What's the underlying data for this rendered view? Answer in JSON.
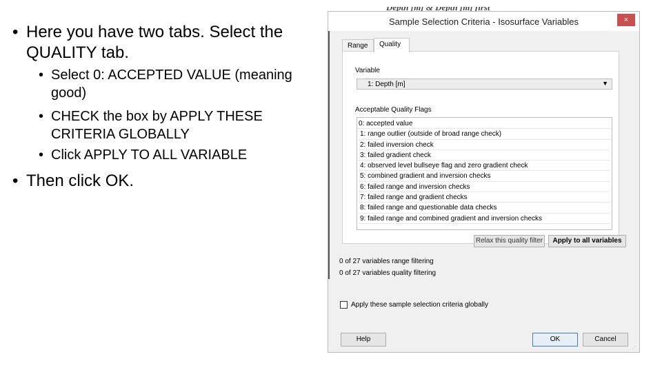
{
  "slide": {
    "bullets": [
      {
        "level": 1,
        "text": "Here you have two tabs.  Select the QUALITY tab."
      },
      {
        "level": 2,
        "text": "Select 0: ACCEPTED VALUE (meaning good)"
      },
      {
        "level": 2,
        "text": "CHECK the box by APPLY THESE CRITERIA GLOBALLY"
      },
      {
        "level": 2,
        "text": "Click APPLY TO ALL VARIABLE"
      },
      {
        "level": 1,
        "text": "Then click OK."
      }
    ]
  },
  "dialog": {
    "cut_title": "Depth [m] & Depth [m] first",
    "title": "Sample Selection Criteria - Isosurface Variables",
    "close_glyph": "×",
    "tabs": [
      {
        "label": "Range"
      },
      {
        "label": "Quality"
      }
    ],
    "variable_label": "Variable",
    "variable_selected": "1: Depth [m]",
    "dropdown_glyph": "▼",
    "flags_label": "Acceptable Quality Flags",
    "flags": [
      "0: accepted value",
      "1: range outlier (outside of broad range check)",
      "2: failed inversion check",
      "3: failed gradient check",
      "4: observed level bullseye flag and zero gradient check",
      "5: combined gradient and inversion checks",
      "6: failed range and inversion checks",
      "7: failed range and gradient checks",
      "8: failed range and questionable data checks",
      "9: failed range and combined gradient and inversion checks"
    ],
    "relax_button": "Relax this quality filter",
    "apply_all_button": "Apply to all variables",
    "status_range": "0 of 27 variables range filtering",
    "status_quality": "0 of 27 variables quality filtering",
    "apply_globally_label": "Apply these sample selection criteria globally",
    "apply_globally_checked": false,
    "help_button": "Help",
    "ok_button": "OK",
    "cancel_button": "Cancel"
  }
}
